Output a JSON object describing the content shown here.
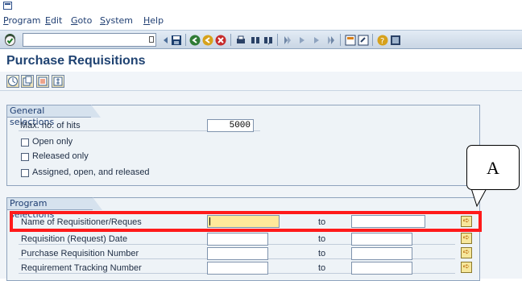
{
  "menu": {
    "items": [
      {
        "label": "Program"
      },
      {
        "label": "Edit"
      },
      {
        "label": "Goto"
      },
      {
        "label": "System"
      },
      {
        "label": "Help"
      }
    ]
  },
  "toolbar": {
    "command_value": "",
    "icons": [
      "enter-icon",
      "back-icon",
      "save-icon",
      "exit-icon",
      "cancel-icon",
      "print-icon",
      "find-icon",
      "find-next-icon",
      "first-page-icon",
      "previous-page-icon",
      "next-page-icon",
      "last-page-icon",
      "create-session-icon",
      "shortcut-icon",
      "help-icon",
      "layout-icon"
    ]
  },
  "page": {
    "title": "Purchase Requisitions"
  },
  "app_toolbar": {
    "icons": [
      "execute-icon",
      "get-variant-icon",
      "multiple-selection-icon",
      "dynamic-selections-icon"
    ]
  },
  "general": {
    "title": "General selections",
    "max_hits_label": "Max. no. of hits",
    "max_hits_value": "5000",
    "open_only_label": "Open only",
    "released_only_label": "Released only",
    "assigned_label": "Assigned, open, and released"
  },
  "program": {
    "title": "Program selections",
    "to_label": "to",
    "rows": [
      {
        "label": "Name of Requisitioner/Reques",
        "from": "",
        "to": ""
      },
      {
        "label": "Requisition (Request) Date",
        "from": "",
        "to": ""
      },
      {
        "label": "Purchase Requisition Number",
        "from": "",
        "to": ""
      },
      {
        "label": "Requirement Tracking Number",
        "from": "",
        "to": ""
      }
    ]
  },
  "annotation": {
    "callout_label": "A",
    "highlight_color": "#ff1a1a"
  },
  "colors": {
    "title": "#204372",
    "required_field": "#ffe99a",
    "highlight": "#ff1a1a"
  }
}
